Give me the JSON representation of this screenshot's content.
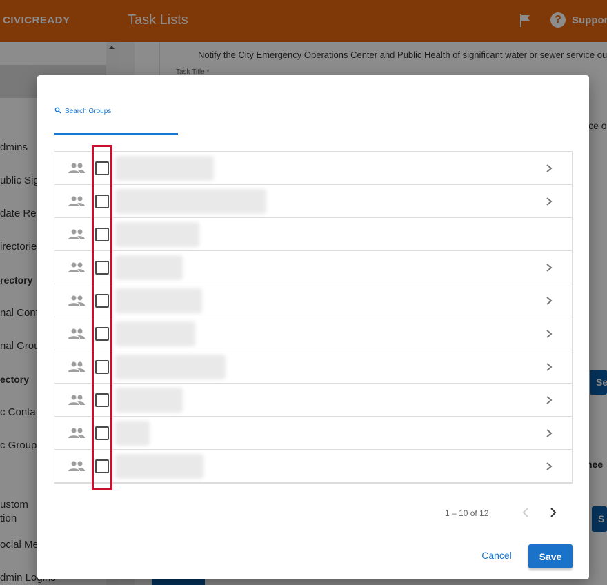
{
  "header": {
    "brand": "CIVICREADY",
    "title": "Task Lists",
    "flag_icon": "flag-icon",
    "help_icon": "help-circle-icon",
    "support_label": "Support"
  },
  "sidebar": {
    "items": [
      {
        "label": "dmins",
        "kind": "item"
      },
      {
        "label": "ublic Sig",
        "kind": "item"
      },
      {
        "label": "date Rer",
        "kind": "item"
      },
      {
        "label": "irectorie",
        "kind": "item"
      },
      {
        "label": "rectory",
        "kind": "heading"
      },
      {
        "label": "nal Conta",
        "kind": "item"
      },
      {
        "label": "nal Grou",
        "kind": "item"
      },
      {
        "label": "ectory",
        "kind": "heading"
      },
      {
        "label": "c Conta",
        "kind": "item"
      },
      {
        "label": "c Group",
        "kind": "item"
      },
      {
        "label": "ustom",
        "kind": "item"
      },
      {
        "label": "tion",
        "kind": "item"
      },
      {
        "label": "ocial Me",
        "kind": "item"
      },
      {
        "label": "dmin Logins",
        "kind": "item"
      }
    ]
  },
  "background": {
    "notify_text": "Notify the City Emergency Operations Center and Public Health of significant water or sewer service out",
    "task_title_label": "Task Title *",
    "right_text": "ice o",
    "button_se": "Se",
    "assignee_fragment": "nee",
    "button_s": "S"
  },
  "dialog": {
    "search": {
      "placeholder": "Search Groups",
      "value": ""
    },
    "groups": [
      {
        "name": "",
        "has_children": true
      },
      {
        "name": "",
        "has_children": true
      },
      {
        "name": "",
        "has_children": false
      },
      {
        "name": "",
        "has_children": true
      },
      {
        "name": "",
        "has_children": true
      },
      {
        "name": "",
        "has_children": true
      },
      {
        "name": "",
        "has_children": true
      },
      {
        "name": "",
        "has_children": true
      },
      {
        "name": "",
        "has_children": true
      },
      {
        "name": "",
        "has_children": true
      }
    ],
    "pagination": {
      "text": "1 – 10 of 12",
      "prev_enabled": false,
      "next_enabled": true
    },
    "cancel_label": "Cancel",
    "save_label": "Save"
  },
  "colors": {
    "header_bg": "#e8660f",
    "accent": "#1976d2",
    "save_bg": "#1a73c9",
    "highlight": "#c8102e"
  }
}
